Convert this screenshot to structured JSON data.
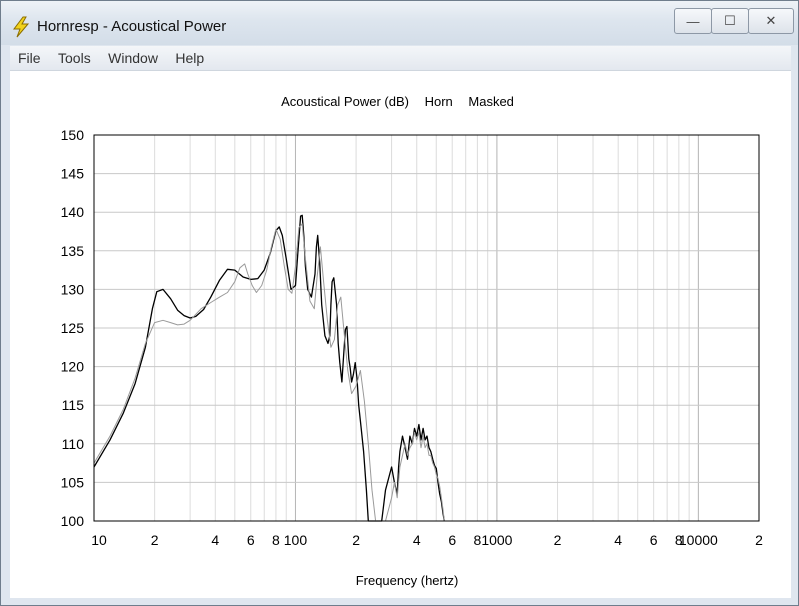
{
  "window": {
    "title": "Hornresp - Acoustical Power",
    "buttons": {
      "minimize": "—",
      "maximize": "☐",
      "close": "✕"
    }
  },
  "menu": [
    "File",
    "Tools",
    "Window",
    "Help"
  ],
  "chart_data": {
    "type": "line",
    "title_parts": [
      "Acoustical Power (dB)",
      "Horn",
      "Masked"
    ],
    "xlabel": "Frequency (hertz)",
    "ylabel": "",
    "x_scale": "log",
    "xlim": [
      10,
      20000
    ],
    "ylim": [
      100,
      150
    ],
    "yticks": [
      100,
      105,
      110,
      115,
      120,
      125,
      130,
      135,
      140,
      145,
      150
    ],
    "xticks": [
      {
        "v": 10,
        "label": "10"
      },
      {
        "v": 20,
        "label": "2"
      },
      {
        "v": 40,
        "label": "4"
      },
      {
        "v": 60,
        "label": "6"
      },
      {
        "v": 80,
        "label": "8"
      },
      {
        "v": 100,
        "label": "100"
      },
      {
        "v": 200,
        "label": "2"
      },
      {
        "v": 400,
        "label": "4"
      },
      {
        "v": 600,
        "label": "6"
      },
      {
        "v": 800,
        "label": "8"
      },
      {
        "v": 1000,
        "label": "1000"
      },
      {
        "v": 2000,
        "label": "2"
      },
      {
        "v": 4000,
        "label": "4"
      },
      {
        "v": 6000,
        "label": "6"
      },
      {
        "v": 8000,
        "label": "8"
      },
      {
        "v": 10000,
        "label": "10000"
      },
      {
        "v": 20000,
        "label": "2"
      }
    ],
    "grid": true,
    "colors": {
      "series_primary": "#000000",
      "series_masked": "#9a9a9a",
      "grid": "#c0c0c0"
    },
    "series": [
      {
        "style": "primary",
        "x": [
          10,
          12,
          14,
          16,
          18,
          19.5,
          20.5,
          22,
          24,
          26,
          28,
          30,
          32,
          35,
          38,
          42,
          46,
          50,
          55,
          60,
          65,
          70,
          75,
          80,
          83,
          86,
          90,
          95,
          100,
          103,
          106,
          108,
          110,
          112,
          115,
          120,
          125,
          127,
          129,
          132,
          135,
          140,
          145,
          148,
          150,
          152,
          155,
          160,
          163,
          166,
          170,
          174,
          177,
          180,
          184,
          187,
          190,
          194,
          198,
          202,
          206,
          212,
          218,
          225,
          230,
          240,
          250,
          258,
          268,
          280,
          300,
          310,
          320,
          325,
          330,
          340,
          350,
          360,
          370,
          380,
          390,
          400,
          410,
          420,
          430,
          440,
          450,
          460,
          470,
          480,
          490,
          500,
          510,
          520,
          530,
          540,
          548
        ],
        "y": [
          107,
          110.5,
          114,
          117.8,
          122.5,
          127.5,
          129.7,
          130,
          128.8,
          127.3,
          126.6,
          126.3,
          126.5,
          127.4,
          129,
          131.2,
          132.6,
          132.5,
          131.6,
          131.3,
          131.4,
          132.5,
          134.7,
          137.6,
          138.1,
          137,
          134,
          130,
          130.5,
          135,
          139.5,
          139.6,
          137,
          133,
          130,
          129,
          132,
          135.5,
          137,
          133.5,
          128,
          124,
          123,
          124,
          128,
          131,
          131.5,
          128,
          123,
          120.5,
          118,
          122,
          124.8,
          125.2,
          121,
          119.8,
          118,
          119,
          120.5,
          118.5,
          115,
          112,
          109,
          104,
          100,
          100,
          100,
          100,
          100,
          104,
          107,
          105,
          103.5,
          107,
          109,
          111,
          109.5,
          108,
          111,
          110,
          112,
          111,
          112.5,
          110.5,
          112,
          110.5,
          111,
          109.5,
          109,
          108,
          107.2,
          106.8,
          105,
          103.5,
          102.5,
          101,
          100
        ]
      },
      {
        "style": "masked",
        "x": [
          10,
          12,
          14,
          16,
          18,
          20,
          22,
          24,
          26,
          28,
          30,
          34,
          38,
          42,
          46,
          50,
          53,
          56,
          58,
          61,
          64,
          68,
          72,
          76,
          80,
          84,
          88,
          92,
          96,
          100,
          104,
          108,
          112,
          118,
          124,
          128,
          133,
          138,
          144,
          150,
          156,
          162,
          168,
          175,
          182,
          190,
          200,
          210,
          220,
          230,
          240,
          250,
          260,
          268,
          280,
          300,
          310,
          320,
          330,
          340,
          350,
          360,
          370,
          380,
          390,
          400,
          410,
          420,
          430,
          440,
          450,
          460,
          470,
          480,
          490,
          500,
          510,
          520,
          530,
          540,
          548
        ],
        "y": [
          107.5,
          111,
          114.5,
          118.5,
          123,
          125.7,
          126,
          125.7,
          125.4,
          125.5,
          126,
          127.5,
          128.3,
          129,
          129.6,
          131,
          132.8,
          133.3,
          132,
          130.5,
          129.6,
          130.5,
          132.5,
          135.5,
          137.8,
          136.5,
          133,
          130,
          129.5,
          133,
          138,
          138.5,
          134,
          128.5,
          127.5,
          131.5,
          135.5,
          131,
          126,
          122.5,
          123.5,
          128,
          129,
          124,
          119.5,
          116.5,
          117.5,
          119.5,
          115.5,
          110,
          104,
          100,
          100,
          100,
          100,
          103,
          105,
          103,
          107,
          108.5,
          110,
          108.5,
          109.5,
          110,
          111.5,
          110.5,
          111.5,
          109.5,
          111,
          109.5,
          110,
          108.5,
          108.5,
          107.5,
          107,
          106,
          105.5,
          104.5,
          103,
          101.5,
          100
        ]
      }
    ]
  }
}
